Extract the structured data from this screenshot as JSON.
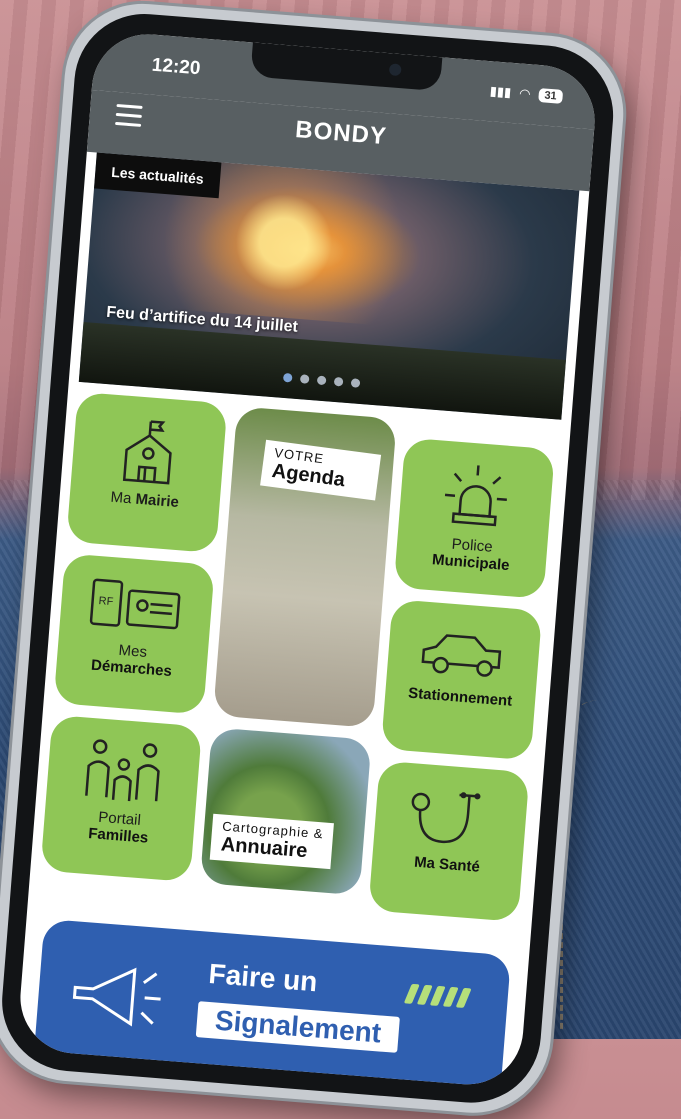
{
  "status_bar": {
    "time": "12:20",
    "battery": "31"
  },
  "app_bar": {
    "brand": "BONDY"
  },
  "news": {
    "tag": "Les actualités",
    "title": "Feu d’artifice du 14 juillet",
    "slides": 5,
    "active_slide": 0
  },
  "tiles": {
    "mairie": {
      "top": "Ma",
      "bot": "Mairie",
      "icon": "town-hall-icon"
    },
    "agenda": {
      "top": "VOTRE",
      "bot": "Agenda"
    },
    "police": {
      "top": "Police",
      "bot": "Municipale",
      "icon": "siren-icon"
    },
    "demarches": {
      "top": "Mes",
      "bot": "Démarches",
      "icon": "id-card-icon"
    },
    "stationnement": {
      "label": "Stationnement",
      "icon": "car-icon"
    },
    "familles": {
      "top": "Portail",
      "bot": "Familles",
      "icon": "family-icon"
    },
    "carto": {
      "top": "Cartographie &",
      "bot": "Annuaire"
    },
    "sante": {
      "label": "Ma Santé",
      "icon": "stethoscope-icon"
    }
  },
  "report": {
    "line1": "Faire un",
    "line2": "Signalement",
    "icon": "megaphone-icon"
  },
  "colors": {
    "tile_green": "#8fc656",
    "report_blue": "#2f5fb0",
    "app_bar": "#585f62"
  }
}
